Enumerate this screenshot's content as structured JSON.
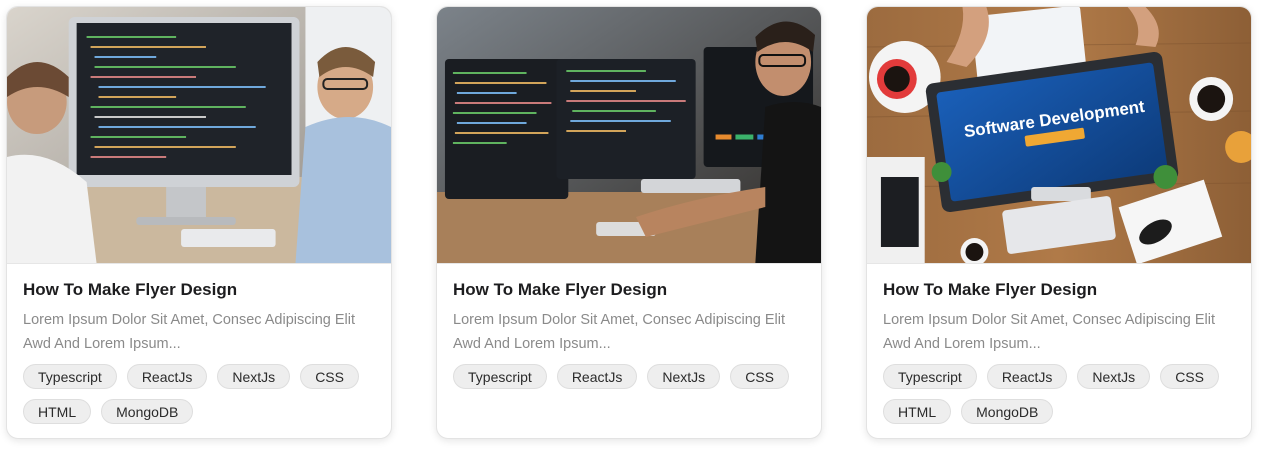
{
  "cards": [
    {
      "image_icon": "photo-two-developers-imac",
      "title": "How To Make Flyer Design",
      "description": "Lorem Ipsum Dolor Sit Amet, Consec Adipiscing Elit Awd And Lorem Ipsum...",
      "tags": [
        "Typescript",
        "ReactJs",
        "NextJs",
        "CSS",
        "HTML",
        "MongoDB"
      ]
    },
    {
      "image_icon": "photo-developer-dual-monitors",
      "title": "How To Make Flyer Design",
      "description": "Lorem Ipsum Dolor Sit Amet, Consec Adipiscing Elit Awd And Lorem Ipsum...",
      "tags": [
        "Typescript",
        "ReactJs",
        "NextJs",
        "CSS"
      ]
    },
    {
      "image_icon": "photo-software-development-desk",
      "image_text": "Software Development",
      "title": "How To Make Flyer Design",
      "description": "Lorem Ipsum Dolor Sit Amet, Consec Adipiscing Elit Awd And Lorem Ipsum...",
      "tags": [
        "Typescript",
        "ReactJs",
        "NextJs",
        "CSS",
        "HTML",
        "MongoDB"
      ]
    }
  ]
}
